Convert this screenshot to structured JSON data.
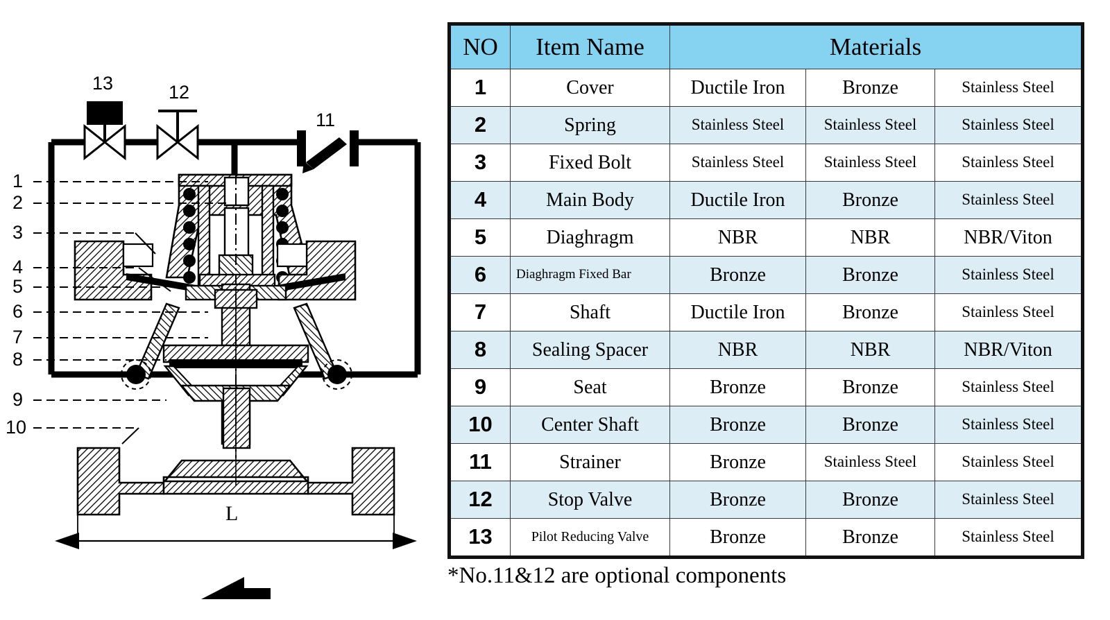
{
  "diagram": {
    "title_hidden": "",
    "dimension_label": "L",
    "callouts_left": [
      "1",
      "2",
      "3",
      "4",
      "5",
      "6",
      "7",
      "8",
      "9",
      "10"
    ],
    "callouts_top": [
      "13",
      "12",
      "11"
    ],
    "symbols": {
      "pilot_reducing_valve": "13",
      "stop_valve": "12",
      "strainer": "11",
      "flow_arrow": "flow-direction-arrow"
    }
  },
  "table": {
    "headers": [
      "NO",
      "Item Name",
      "Materials"
    ],
    "rows": [
      {
        "no": "1",
        "item": "Cover",
        "item_style": "normal",
        "m1": "Ductile Iron",
        "m1_small": false,
        "m2": "Bronze",
        "m2_small": false,
        "m3": "Stainless Steel",
        "m3_small": true,
        "alt": false
      },
      {
        "no": "2",
        "item": "Spring",
        "item_style": "normal",
        "m1": "Stainless Steel",
        "m1_small": true,
        "m2": "Stainless Steel",
        "m2_small": true,
        "m3": "Stainless Steel",
        "m3_small": true,
        "alt": true
      },
      {
        "no": "3",
        "item": "Fixed Bolt",
        "item_style": "normal",
        "m1": "Stainless Steel",
        "m1_small": true,
        "m2": "Stainless Steel",
        "m2_small": true,
        "m3": "Stainless Steel",
        "m3_small": true,
        "alt": false
      },
      {
        "no": "4",
        "item": "Main Body",
        "item_style": "normal",
        "m1": "Ductile Iron",
        "m1_small": false,
        "m2": "Bronze",
        "m2_small": false,
        "m3": "Stainless Steel",
        "m3_small": true,
        "alt": true
      },
      {
        "no": "5",
        "item": "Diaghragm",
        "item_style": "normal",
        "m1": "NBR",
        "m1_small": false,
        "m2": "NBR",
        "m2_small": false,
        "m3": "NBR/Viton",
        "m3_small": false,
        "alt": false
      },
      {
        "no": "6",
        "item": "Diaghragm Fixed Bar",
        "item_style": "wrapleft",
        "m1": "Bronze",
        "m1_small": false,
        "m2": "Bronze",
        "m2_small": false,
        "m3": "Stainless Steel",
        "m3_small": true,
        "alt": true
      },
      {
        "no": "7",
        "item": "Shaft",
        "item_style": "normal",
        "m1": "Ductile Iron",
        "m1_small": false,
        "m2": "Bronze",
        "m2_small": false,
        "m3": "Stainless Steel",
        "m3_small": true,
        "alt": false
      },
      {
        "no": "8",
        "item": "Sealing Spacer",
        "item_style": "normal",
        "m1": "NBR",
        "m1_small": false,
        "m2": "NBR",
        "m2_small": false,
        "m3": "NBR/Viton",
        "m3_small": false,
        "alt": true
      },
      {
        "no": "9",
        "item": "Seat",
        "item_style": "normal",
        "m1": "Bronze",
        "m1_small": false,
        "m2": "Bronze",
        "m2_small": false,
        "m3": "Stainless Steel",
        "m3_small": true,
        "alt": false
      },
      {
        "no": "10",
        "item": "Center Shaft",
        "item_style": "normal",
        "m1": "Bronze",
        "m1_small": false,
        "m2": "Bronze",
        "m2_small": false,
        "m3": "Stainless Steel",
        "m3_small": true,
        "alt": true
      },
      {
        "no": "11",
        "item": "Strainer",
        "item_style": "normal",
        "m1": "Bronze",
        "m1_small": false,
        "m2": "Stainless Steel",
        "m2_small": true,
        "m3": "Stainless Steel",
        "m3_small": true,
        "alt": false
      },
      {
        "no": "12",
        "item": "Stop Valve",
        "item_style": "normal",
        "m1": "Bronze",
        "m1_small": false,
        "m2": "Bronze",
        "m2_small": false,
        "m3": "Stainless Steel",
        "m3_small": true,
        "alt": true
      },
      {
        "no": "13",
        "item": "Pilot Reducing Valve",
        "item_style": "small",
        "m1": "Bronze",
        "m1_small": false,
        "m2": "Bronze",
        "m2_small": false,
        "m3": "Stainless Steel",
        "m3_small": true,
        "alt": false
      }
    ]
  },
  "footnote": "*No.11&12 are optional components",
  "colors": {
    "header_blue": "#85d3f0",
    "row_blue": "#dcedf6",
    "line": "#111111",
    "text": "#000000"
  }
}
